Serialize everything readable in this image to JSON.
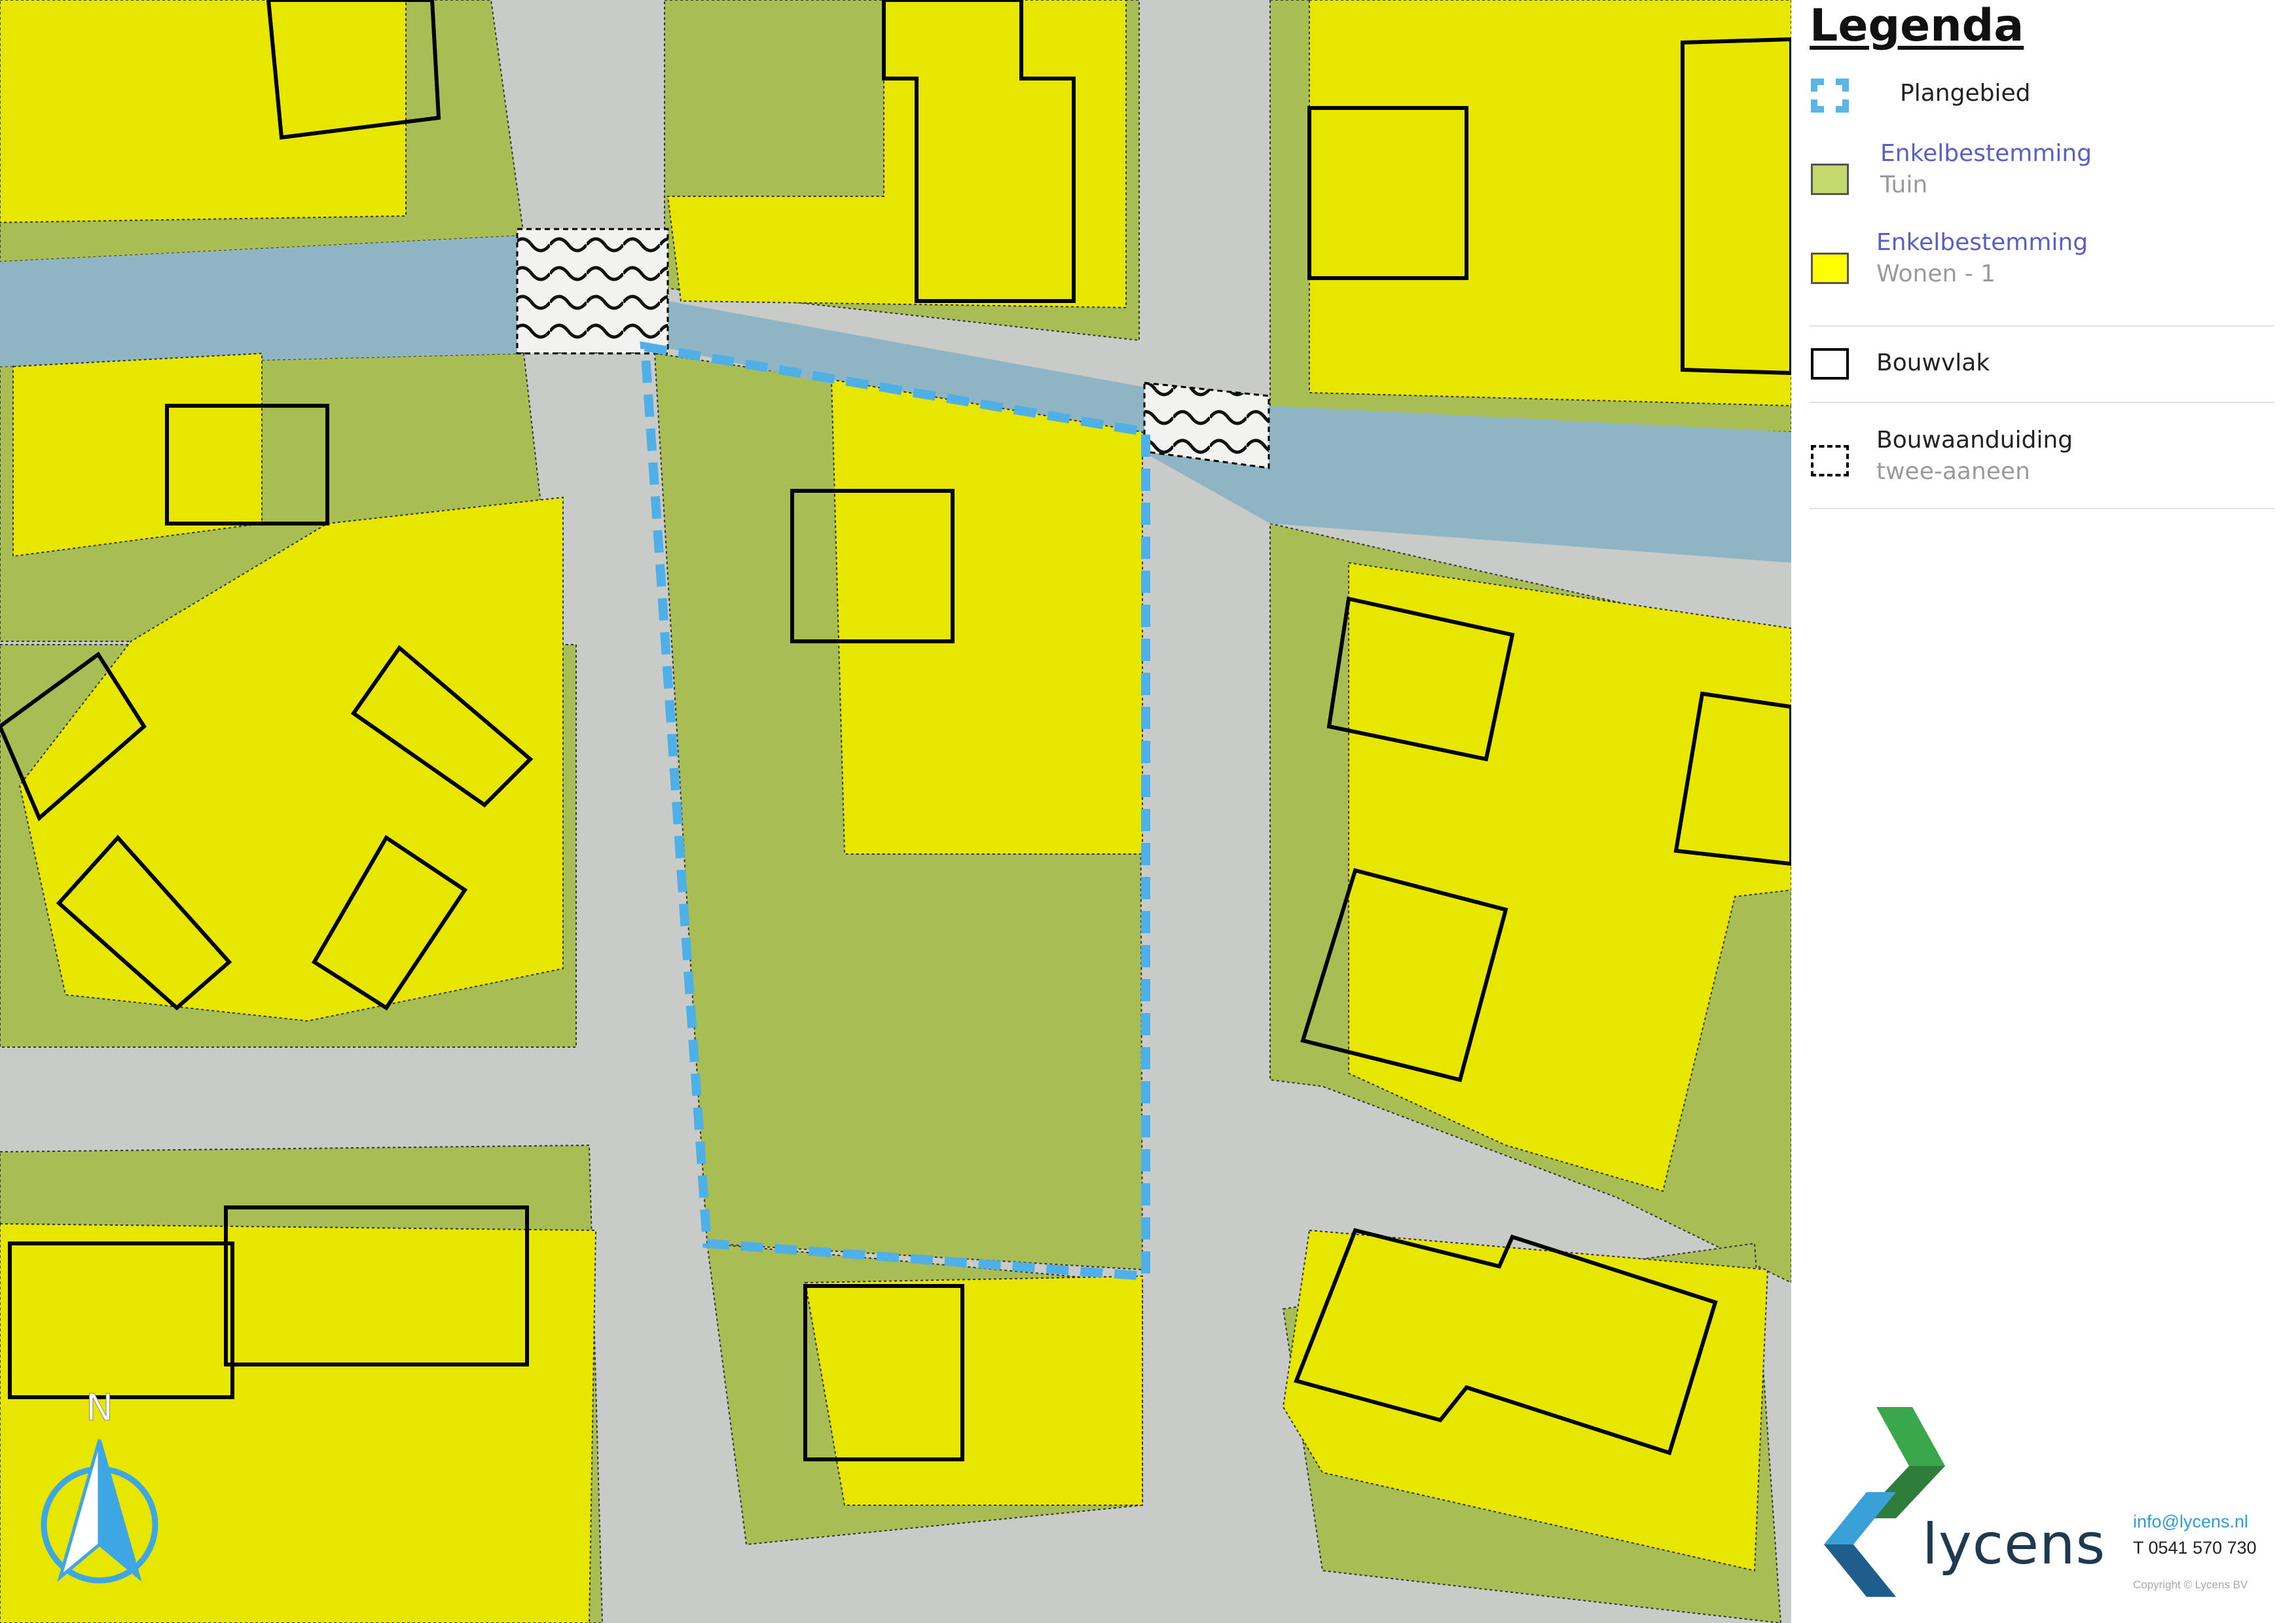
{
  "legend": {
    "title": "Legenda",
    "items": [
      {
        "label": "Plangebied",
        "sub": "",
        "symbol": "dashed-blue-outline",
        "color": "#5ab4e6"
      },
      {
        "label": "Enkelbestemming",
        "sub": "Tuin",
        "symbol": "fill",
        "color": "#c5d86d"
      },
      {
        "label": "Enkelbestemming",
        "sub": "Wonen - 1",
        "symbol": "fill",
        "color": "#ffff00"
      },
      {
        "label": "Bouwvlak",
        "sub": "",
        "symbol": "black-outline",
        "color": "#000000"
      },
      {
        "label": "Bouwaanduiding",
        "sub": "twee-aaneen",
        "symbol": "dashed-black-outline",
        "color": "#000000"
      }
    ]
  },
  "brand": {
    "name": "lycens",
    "email": "info@lycens.nl",
    "phone": "T 0541 570 730",
    "copyright": "Copyright © Lycens BV"
  },
  "north_arrow": {
    "label": "N"
  },
  "colors": {
    "wonen": "#e6e600",
    "tuin": "#a9bd55",
    "water": "#8fb5c4",
    "road": "#c9cbc9",
    "plangebied": "#4fb0e8"
  }
}
